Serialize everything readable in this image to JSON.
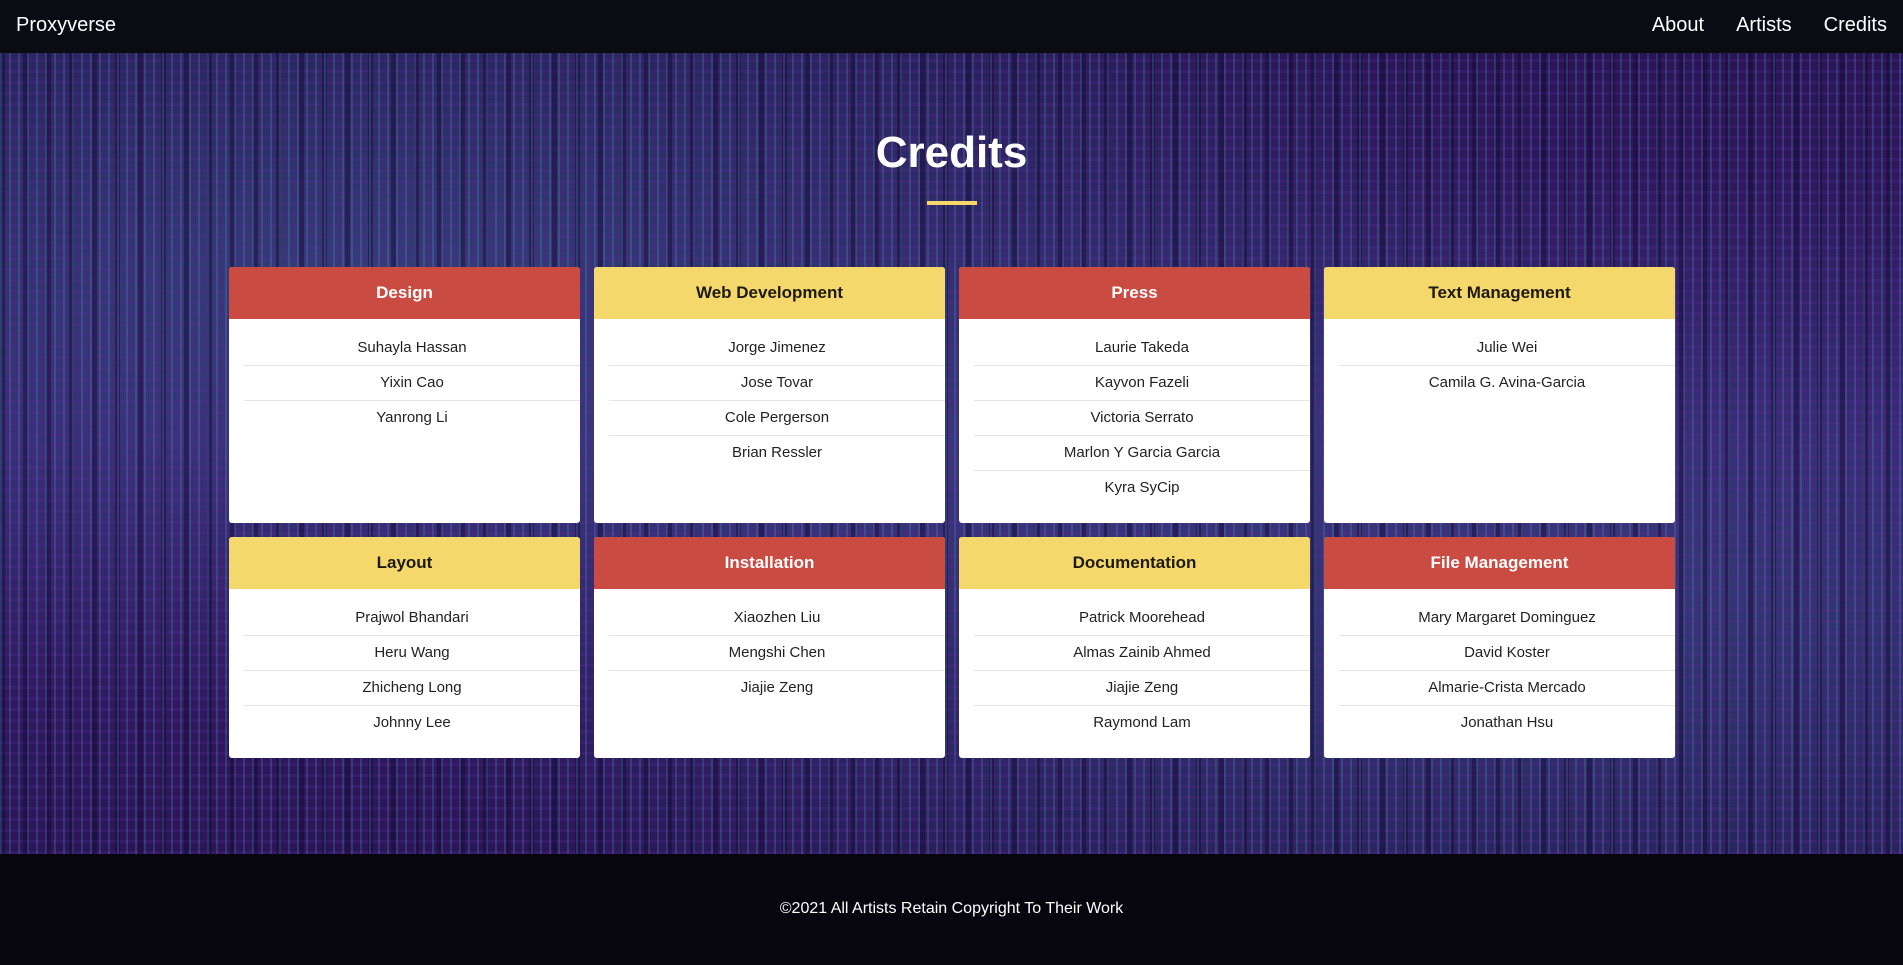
{
  "nav": {
    "brand": "Proxyverse",
    "links": [
      "About",
      "Artists",
      "Credits"
    ]
  },
  "page": {
    "title": "Credits"
  },
  "colors": {
    "accent_red": "#c94b42",
    "accent_yellow": "#f5d86b",
    "background_purple": "#2b1556"
  },
  "cards": [
    {
      "title": "Design",
      "color": "red",
      "names": [
        "Suhayla Hassan",
        "Yixin Cao",
        "Yanrong Li"
      ]
    },
    {
      "title": "Web Development",
      "color": "yellow",
      "names": [
        "Jorge Jimenez",
        "Jose Tovar",
        "Cole Pergerson",
        "Brian Ressler"
      ]
    },
    {
      "title": "Press",
      "color": "red",
      "names": [
        "Laurie Takeda",
        "Kayvon Fazeli",
        "Victoria Serrato",
        "Marlon Y Garcia Garcia",
        "Kyra SyCip"
      ]
    },
    {
      "title": "Text Management",
      "color": "yellow",
      "names": [
        "Julie Wei",
        "Camila G. Avina-Garcia"
      ]
    },
    {
      "title": "Layout",
      "color": "yellow",
      "names": [
        "Prajwol Bhandari",
        "Heru Wang",
        "Zhicheng Long",
        "Johnny Lee"
      ]
    },
    {
      "title": "Installation",
      "color": "red",
      "names": [
        "Xiaozhen Liu",
        "Mengshi Chen",
        "Jiajie Zeng"
      ]
    },
    {
      "title": "Documentation",
      "color": "yellow",
      "names": [
        "Patrick Moorehead",
        "Almas Zainib Ahmed",
        "Jiajie Zeng",
        "Raymond Lam"
      ]
    },
    {
      "title": "File Management",
      "color": "red",
      "names": [
        "Mary Margaret Dominguez",
        "David Koster",
        "Almarie-Crista Mercado",
        "Jonathan Hsu"
      ]
    }
  ],
  "footer": {
    "text": "©2021 All Artists Retain Copyright To Their Work"
  }
}
